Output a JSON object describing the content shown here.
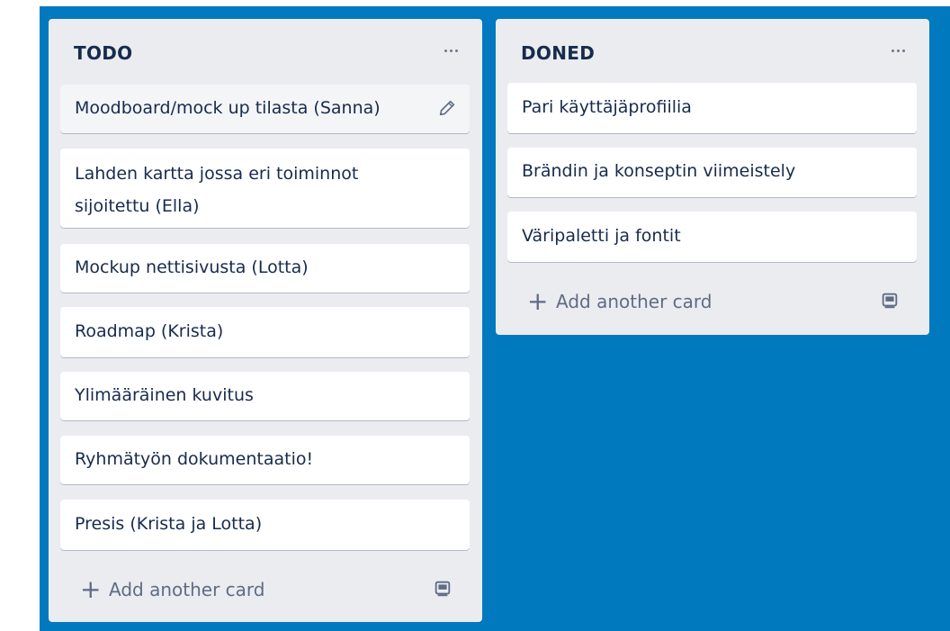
{
  "lists": [
    {
      "title": "TODO",
      "cards": [
        "Moodboard/mock up tilasta (Sanna)",
        "Lahden kartta jossa eri toiminnot sijoitettu (Ella)",
        "Mockup nettisivusta (Lotta)",
        "Roadmap (Krista)",
        "Ylimääräinen kuvitus",
        "Ryhmätyön dokumentaatio!",
        "Presis (Krista ja Lotta)"
      ],
      "add_card_label": "Add another card"
    },
    {
      "title": "DONED",
      "cards": [
        "Pari käyttäjäprofiilia",
        "Brändin ja konseptin viimeistely",
        "Väripaletti ja fontit"
      ],
      "add_card_label": "Add another card"
    }
  ],
  "icons": {
    "list_menu": "more-icon",
    "edit": "pencil-icon",
    "add": "plus-icon",
    "template": "card-template-icon"
  },
  "colors": {
    "board_background": "#0079bf",
    "list_background": "#ebecf0",
    "card_background": "#ffffff",
    "text_primary": "#172b4d",
    "text_secondary": "#5e6c84"
  }
}
